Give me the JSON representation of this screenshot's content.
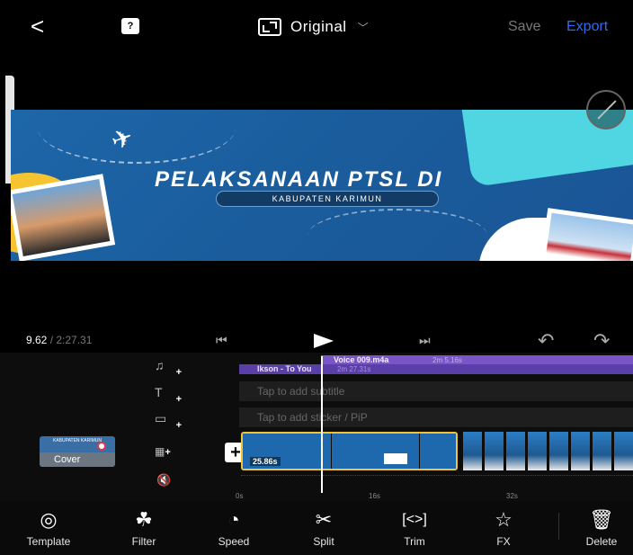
{
  "topbar": {
    "back_glyph": "<",
    "help_glyph": "?",
    "ratio_label": "Original",
    "save_label": "Save",
    "export_label": "Export"
  },
  "preview": {
    "title": "PELAKSANAAN PTSL DI",
    "subtitle": "KABUPATEN KARIMUN"
  },
  "playback": {
    "current_time": "9.62",
    "total_time": " / 2:27.31"
  },
  "tracks": {
    "voice_name": "Voice 009.m4a",
    "voice_duration": "2m 5.16s",
    "music_name": "Ikson - To You",
    "music_duration": "2m 27.31s",
    "subtitle_placeholder": "Tap to add subtitle",
    "sticker_placeholder": "Tap to add sticker / PiP",
    "cover_label": "Cover",
    "cover_title": "KABUPATEN KARIMUN",
    "clip_duration": "25.86s"
  },
  "ruler": {
    "marks": [
      "0s",
      "16s",
      "32s"
    ]
  },
  "toolbar": {
    "items": [
      {
        "label": "Template",
        "icon": "template-icon"
      },
      {
        "label": "Filter",
        "icon": "filter-icon"
      },
      {
        "label": "Speed",
        "icon": "speed-icon"
      },
      {
        "label": "Split",
        "icon": "split-icon"
      },
      {
        "label": "Trim",
        "icon": "trim-icon"
      },
      {
        "label": "FX",
        "icon": "fx-icon"
      },
      {
        "label": "Delete",
        "icon": "delete-icon"
      }
    ]
  },
  "colors": {
    "accent": "#2f6cf2",
    "clip_border": "#f2c230",
    "voice_track": "#7a55c8",
    "music_track": "#5b3fa8"
  }
}
